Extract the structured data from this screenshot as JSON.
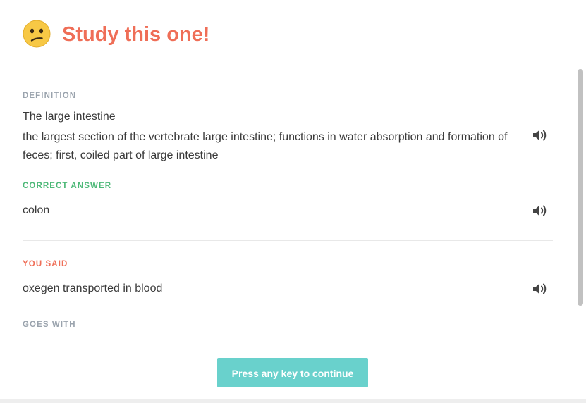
{
  "header": {
    "emoji_icon": "confused-face-icon",
    "title": "Study this one!",
    "accent_color": "#ef6e57"
  },
  "definition": {
    "label": "DEFINITION",
    "term": "The large intestine",
    "description": "the largest section of the vertebrate large intestine; functions in water absorption and formation of feces; first, coiled part of large intestine",
    "audio_icon": "speaker-icon"
  },
  "correct_answer": {
    "label": "CORRECT ANSWER",
    "value": "colon",
    "label_color": "#4cb877",
    "audio_icon": "speaker-icon"
  },
  "you_said": {
    "label": "YOU SAID",
    "value": "oxegen transported in blood",
    "label_color": "#ef6e57",
    "audio_icon": "speaker-icon"
  },
  "goes_with": {
    "label": "GOES WITH"
  },
  "footer": {
    "continue_label": "Press any key to continue",
    "button_color": "#69d1cc"
  }
}
